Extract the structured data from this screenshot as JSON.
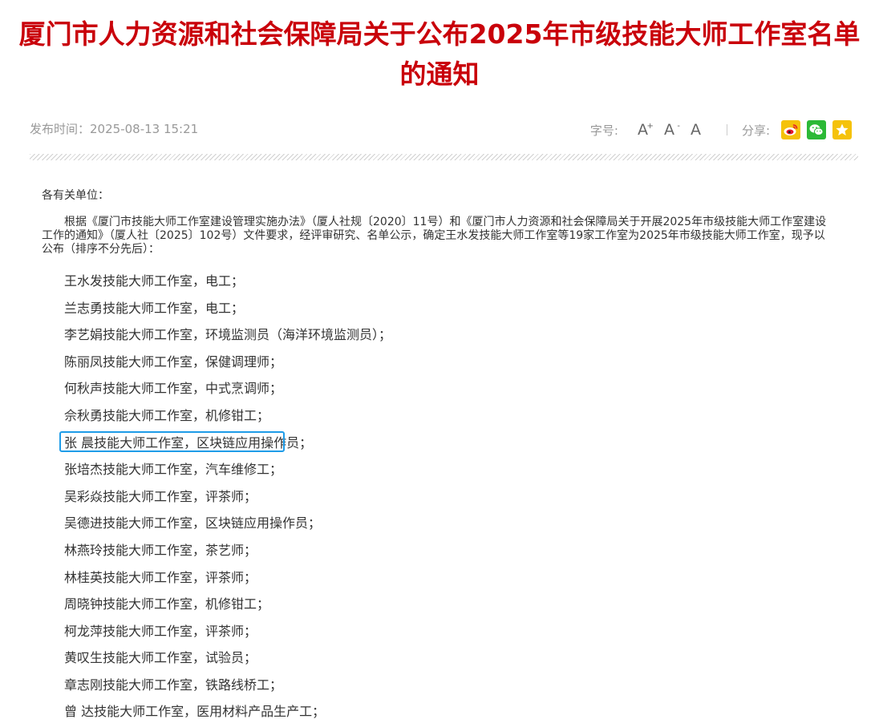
{
  "article": {
    "title_line1": "厦门市人力资源和社会保障局关于公布2025年市级技能大师工作室名单",
    "title_line2": "的通知",
    "publish_label": "发布时间：",
    "publish_time": "2025-08-13 15:21",
    "font_size_label": "字号:",
    "font_large": "A",
    "font_large_sup": "+",
    "font_small": "A",
    "font_small_sup": "-",
    "font_normal": "A",
    "share_label": "分享:",
    "greeting": "各有关单位：",
    "intro": "根据《厦门市技能大师工作室建设管理实施办法》（厦人社规〔2020〕11号）和《厦门市人力资源和社会保障局关于开展2025年市级技能大师工作室建设工作的通知》（厦人社〔2025〕102号）文件要求，经评审研究、名单公示，确定王水发技能大师工作室等19家工作室为2025年市级技能大师工作室，现予以公布（排序不分先后）：",
    "list": [
      "王水发技能大师工作室，电工；",
      "兰志勇技能大师工作室，电工；",
      "李艺娟技能大师工作室，环境监测员（海洋环境监测员）；",
      "陈丽凤技能大师工作室，保健调理师；",
      "何秋声技能大师工作室，中式烹调师；",
      "佘秋勇技能大师工作室，机修钳工；",
      "张 晨技能大师工作室，区块链应用操作员；",
      "张培杰技能大师工作室，汽车维修工；",
      "吴彩焱技能大师工作室，评茶师；",
      "吴德进技能大师工作室，区块链应用操作员；",
      "林燕玲技能大师工作室，茶艺师；",
      "林桂英技能大师工作室，评茶师；",
      "周晓钟技能大师工作室，机修钳工；",
      "柯龙萍技能大师工作室，评茶师；",
      "黄叹生技能大师工作室，试验员；",
      "章志刚技能大师工作室，铁路线桥工；",
      "曾 达技能大师工作室，医用材料产品生产工；"
    ]
  },
  "icons": {
    "weibo": "weibo-icon",
    "wechat": "wechat-icon",
    "favorite": "star-icon"
  },
  "colors": {
    "title": "#c9000a",
    "highlight_border": "#1e9ce8",
    "meta_text": "#999999"
  }
}
